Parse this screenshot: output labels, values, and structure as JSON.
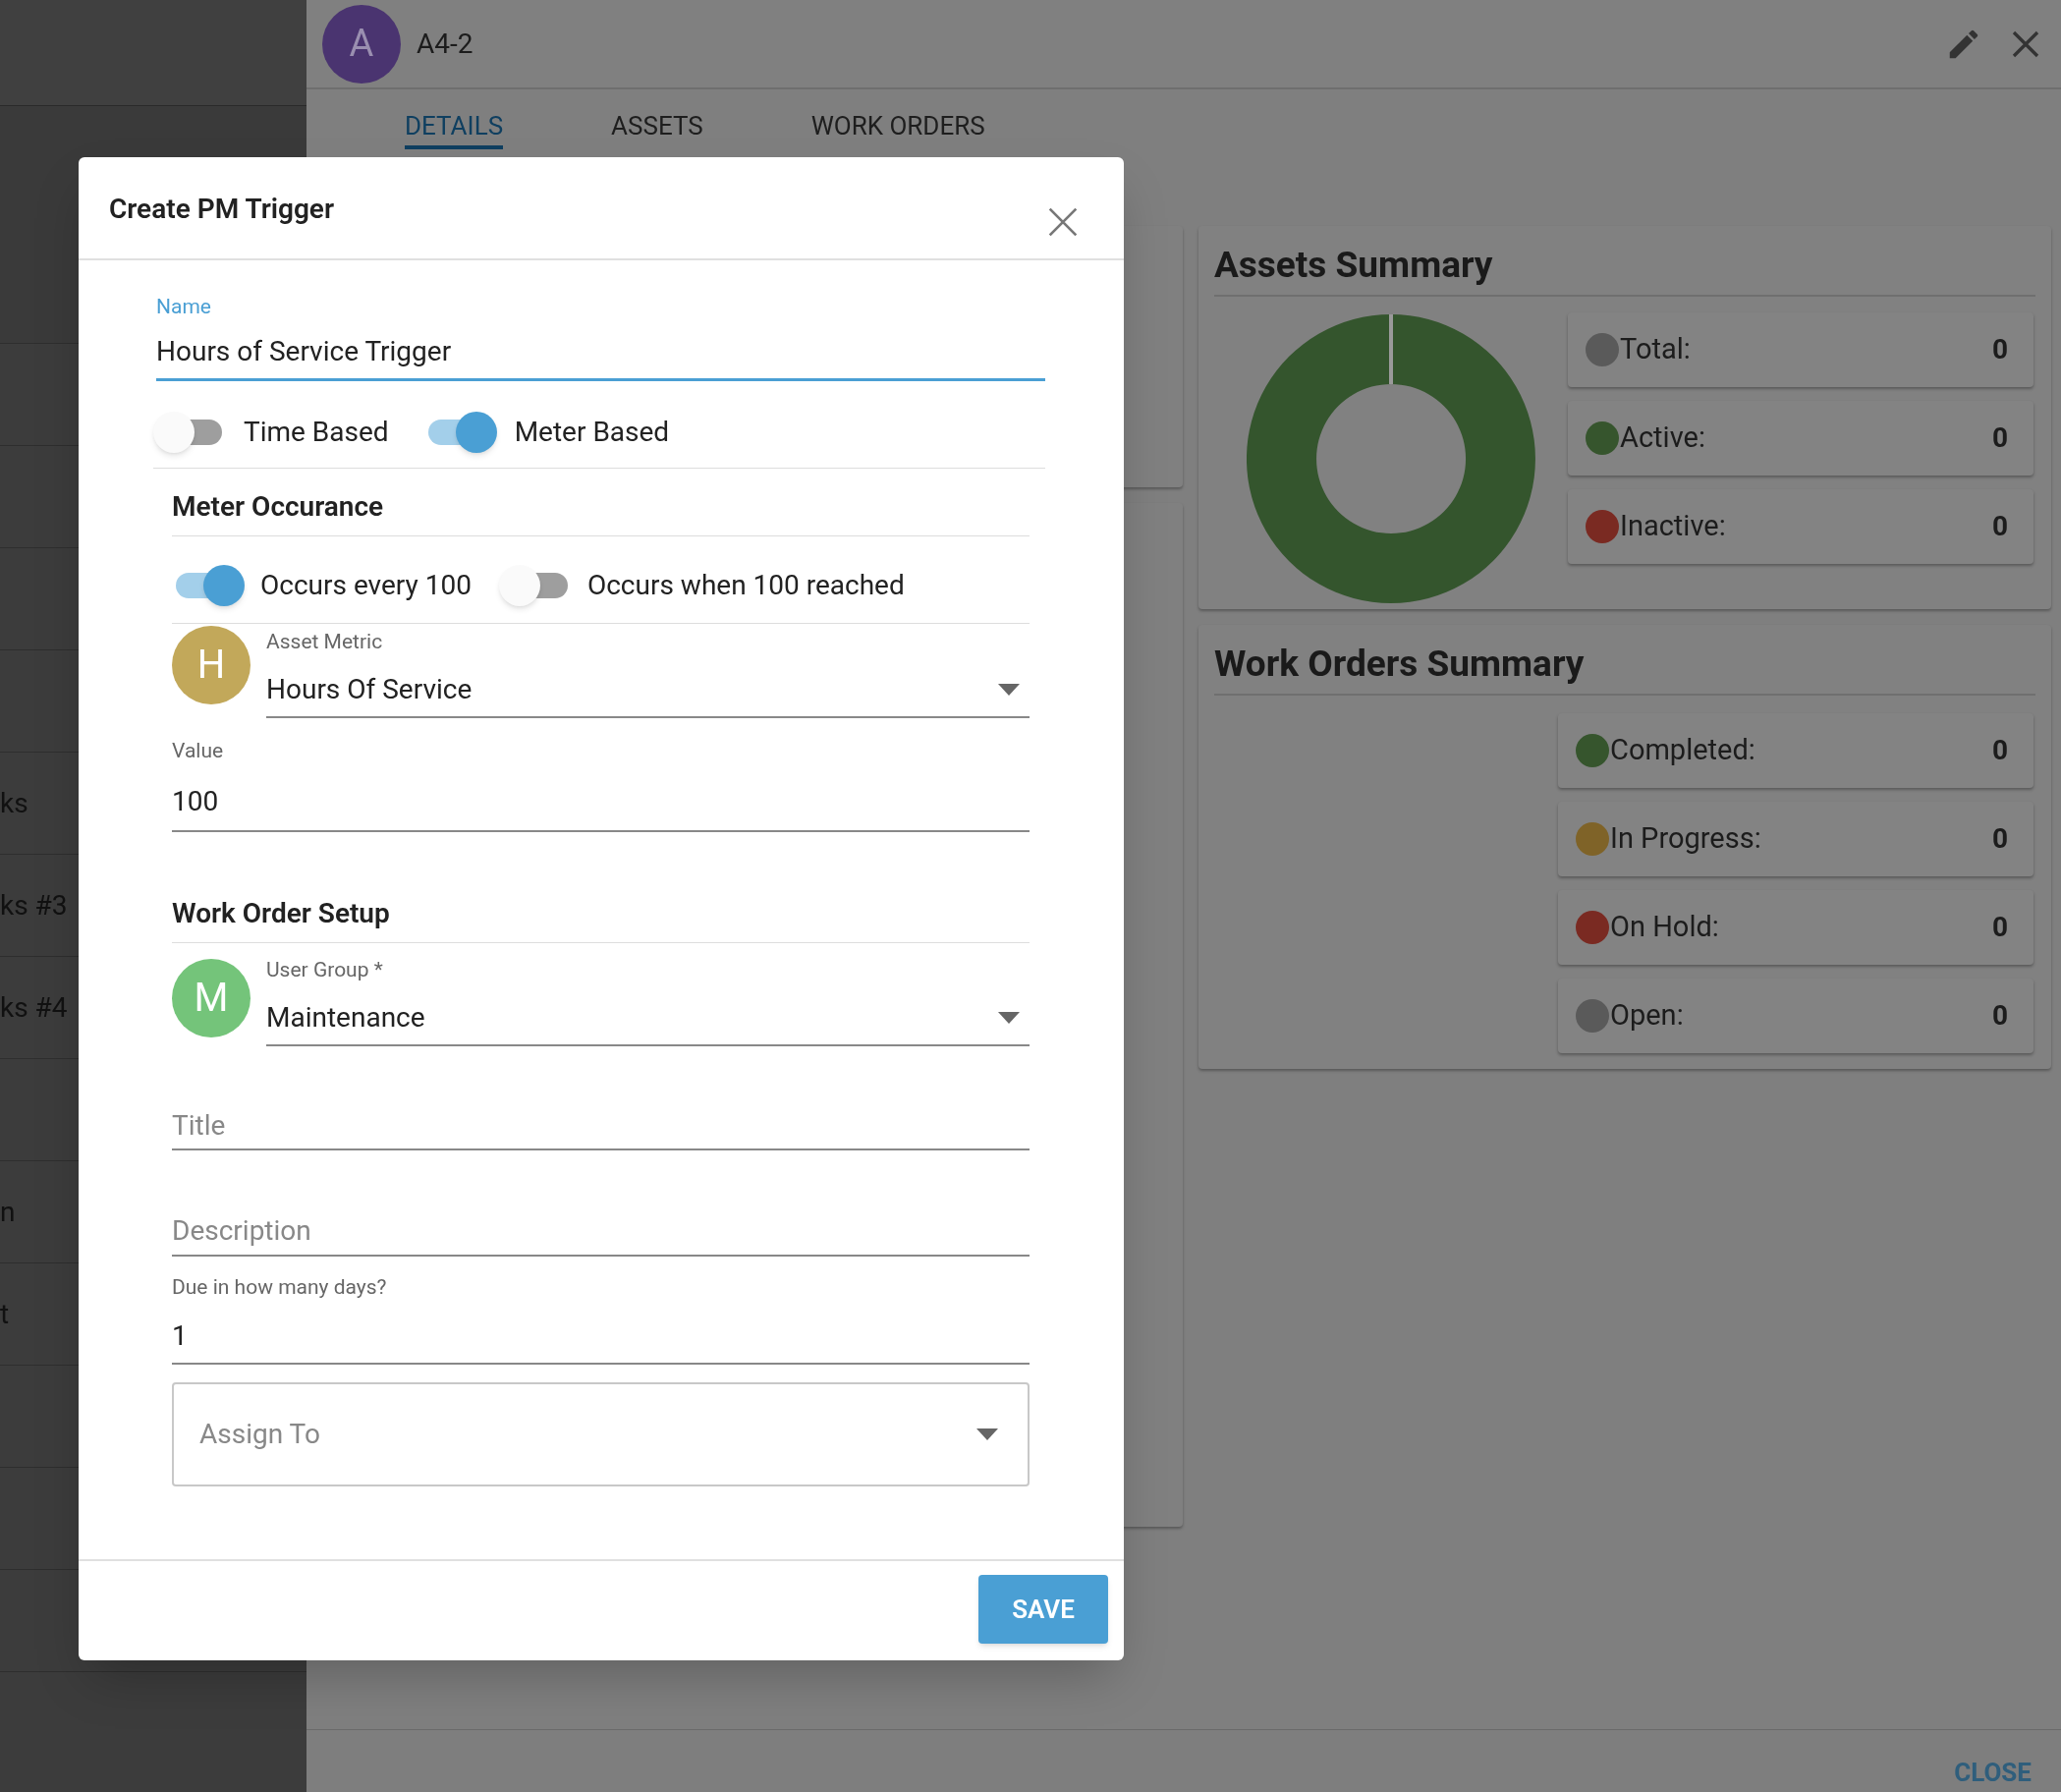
{
  "sidebar": {
    "items": [
      {
        "label": "ks"
      },
      {
        "label": "ks #3"
      },
      {
        "label": "ks #4"
      },
      {
        "label": "n"
      },
      {
        "label": "t"
      }
    ]
  },
  "header": {
    "avatar": "A",
    "title": "A4-2"
  },
  "tabs": [
    {
      "label": "DETAILS",
      "selected": true
    },
    {
      "label": "ASSETS",
      "selected": false
    },
    {
      "label": "WORK ORDERS",
      "selected": false
    }
  ],
  "assets_summary": {
    "title": "Assets Summary",
    "stats": [
      {
        "label": "Total:",
        "value": "0",
        "color": "#5a5a5a"
      },
      {
        "label": "Active:",
        "value": "0",
        "color": "#36552d"
      },
      {
        "label": "Inactive:",
        "value": "0",
        "color": "#7a2a22"
      }
    ]
  },
  "work_orders_summary": {
    "title": "Work Orders Summary",
    "stats": [
      {
        "label": "Completed:",
        "value": "0",
        "color": "#36552d"
      },
      {
        "label": "In Progress:",
        "value": "0",
        "color": "#7f6328"
      },
      {
        "label": "On Hold:",
        "value": "0",
        "color": "#7a2a22"
      },
      {
        "label": "Open:",
        "value": "0",
        "color": "#5a5a5a"
      }
    ]
  },
  "footer": {
    "close_button": "CLOSE"
  },
  "dialog": {
    "title": "Create PM Trigger",
    "name_field": {
      "label": "Name",
      "value": "Hours of Service Trigger"
    },
    "trigger_types": [
      {
        "label": "Time Based",
        "on": false
      },
      {
        "label": "Meter Based",
        "on": true
      }
    ],
    "meter_section": {
      "title": "Meter Occurance",
      "occurrence": [
        {
          "label": "Occurs every 100",
          "on": true
        },
        {
          "label": "Occurs when 100 reached",
          "on": false
        }
      ],
      "asset_metric": {
        "avatar": "H",
        "label": "Asset Metric",
        "value": "Hours Of Service"
      },
      "value_field": {
        "label": "Value",
        "value": "100"
      }
    },
    "work_order_section": {
      "title": "Work Order Setup",
      "user_group": {
        "avatar": "M",
        "label": "User Group *",
        "value": "Maintenance"
      },
      "title_field": {
        "placeholder": "Title"
      },
      "description_field": {
        "placeholder": "Description"
      },
      "due_field": {
        "label": "Due in how many days?",
        "value": "1"
      },
      "assign_to": {
        "placeholder": "Assign To"
      }
    },
    "save_button": "SAVE"
  }
}
